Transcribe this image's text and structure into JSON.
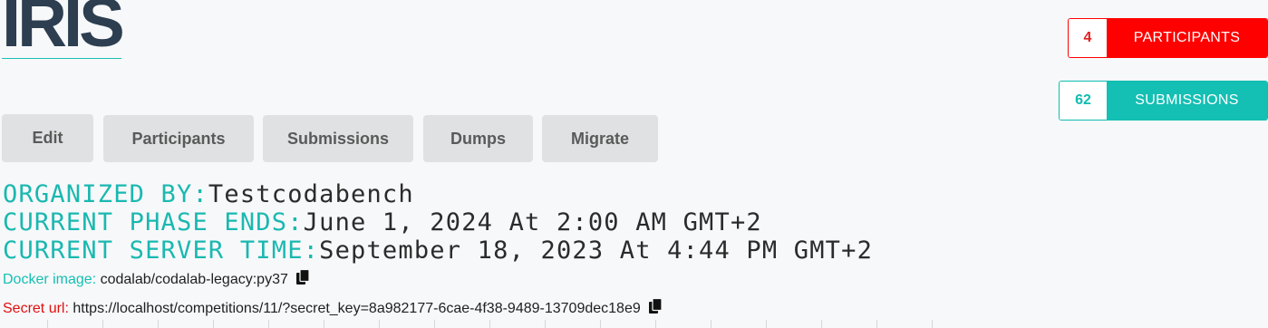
{
  "competition": {
    "title": "IRIS"
  },
  "stats": {
    "participants": {
      "count": "4",
      "label": "PARTICIPANTS"
    },
    "submissions": {
      "count": "62",
      "label": "SUBMISSIONS"
    }
  },
  "tabs": [
    {
      "label": "Edit"
    },
    {
      "label": "Participants"
    },
    {
      "label": "Submissions"
    },
    {
      "label": "Dumps"
    },
    {
      "label": "Migrate"
    }
  ],
  "details": {
    "organized_by": {
      "label": "ORGANIZED BY:",
      "value": "Testcodabench"
    },
    "phase_ends": {
      "label": "CURRENT PHASE ENDS:",
      "value": "June 1, 2024 At 2:00 AM GMT+2"
    },
    "server_time": {
      "label": "CURRENT SERVER TIME:",
      "value": "September 18, 2023 At 4:44 PM GMT+2"
    }
  },
  "docker": {
    "label": "Docker image:",
    "value": "codalab/codalab-legacy:py37"
  },
  "secret": {
    "label": "Secret url:",
    "value": "https://localhost/competitions/11/?secret_key=8a982177-6cae-4f38-9489-13709dec18e9"
  },
  "colors": {
    "accent_teal": "#14bfb3",
    "participants_red": "#ff0000",
    "secret_label_red": "#e01010",
    "title": "#2c3e50"
  },
  "icons": {
    "copy": "copy-icon"
  }
}
